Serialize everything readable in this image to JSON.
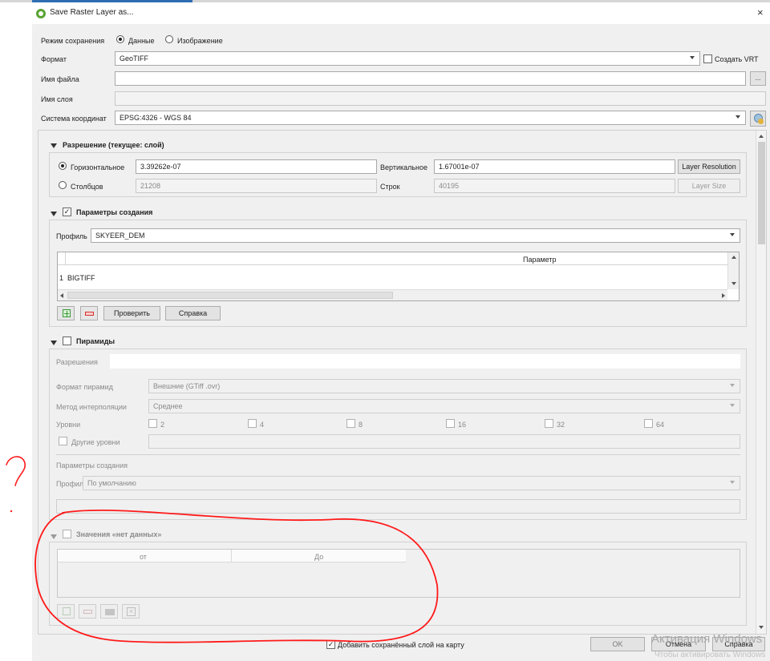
{
  "window": {
    "title": "Save Raster Layer as...",
    "close_glyph": "×"
  },
  "save_mode": {
    "label": "Режим сохранения",
    "option_data": "Данные",
    "option_image": "Изображение",
    "selected": "Данные"
  },
  "format": {
    "label": "Формат",
    "value": "GeoTIFF",
    "create_vrt_label": "Создать VRT"
  },
  "filename": {
    "label": "Имя файла",
    "value": "",
    "browse_label": "..."
  },
  "layer_name": {
    "label": "Имя слоя",
    "value": ""
  },
  "crs": {
    "label": "Система координат",
    "value": "EPSG:4326 - WGS 84"
  },
  "resolution": {
    "title": "Разрешение (текущее: слой)",
    "horizontal_label": "Горизонтальное",
    "horizontal_value": "3.39262e-07",
    "vertical_label": "Вертикальное",
    "vertical_value": "1.67001e-07",
    "layer_resolution_button": "Layer Resolution",
    "columns_label": "Столбцов",
    "columns_value": "21208",
    "rows_label": "Строк",
    "rows_value": "40195",
    "layer_size_button": "Layer Size"
  },
  "creation_options": {
    "title": "Параметры создания",
    "checked": true,
    "profile_label": "Профиль",
    "profile_value": "SKYEER_DEM",
    "table_header": "Параметр",
    "rows": [
      {
        "num": "1",
        "value": "BIGTIFF"
      }
    ],
    "validate_button": "Проверить",
    "help_button": "Справка"
  },
  "pyramids": {
    "title": "Пирамиды",
    "checked": false,
    "resolutions_label": "Разрешения",
    "format_label": "Формат пирамид",
    "format_value": "Внешние (GTiff .ovr)",
    "interp_label": "Метод интерполяции",
    "interp_value": "Среднее",
    "levels_label": "Уровни",
    "levels": [
      "2",
      "4",
      "8",
      "16",
      "32",
      "64"
    ],
    "other_levels_label": "Другие уровни",
    "creation_params_label": "Параметры создания",
    "profile_label": "Профиль",
    "profile_value": "По умолчанию"
  },
  "nodata": {
    "title": "Значения «нет данных»",
    "col_from": "от",
    "col_to": "До"
  },
  "footer": {
    "add_to_map_label": "Добавить сохранённый слой на карту",
    "add_to_map_checked": true,
    "ok_button": "OK",
    "cancel_button": "Отмена",
    "help_button": "Справка"
  },
  "annotation": {
    "mark": "?"
  },
  "watermark": {
    "line1": "Активация Windows",
    "line2": "Чтобы активировать Windows"
  },
  "colors": {
    "qgis_green": "#58a333",
    "annotation_red": "#ff1a1a",
    "add_green": "#3a9a3a",
    "remove_red": "#d83030"
  }
}
